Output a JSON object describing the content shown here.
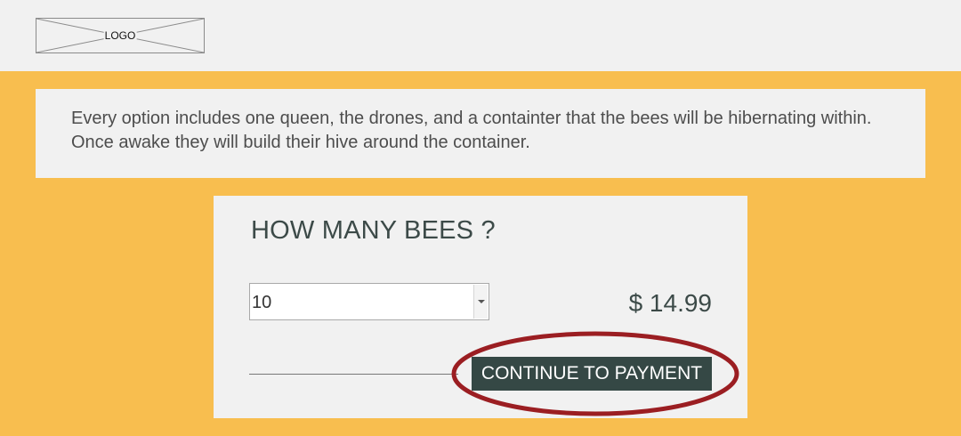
{
  "header": {
    "logo_label": "LOGO"
  },
  "info": {
    "text": "Every option includes one queen, the drones, and a containter that the bees will be hibernating within. Once awake they will build their hive around the container."
  },
  "order": {
    "heading": "HOW MANY BEES ?",
    "quantity_selected": "10",
    "price": "$ 14.99",
    "continue_label": "CONTINUE TO PAYMENT"
  },
  "colors": {
    "background": "#f8be4f",
    "panel": "#f1f1f1",
    "button": "#354845",
    "highlight": "#9b1e22"
  }
}
